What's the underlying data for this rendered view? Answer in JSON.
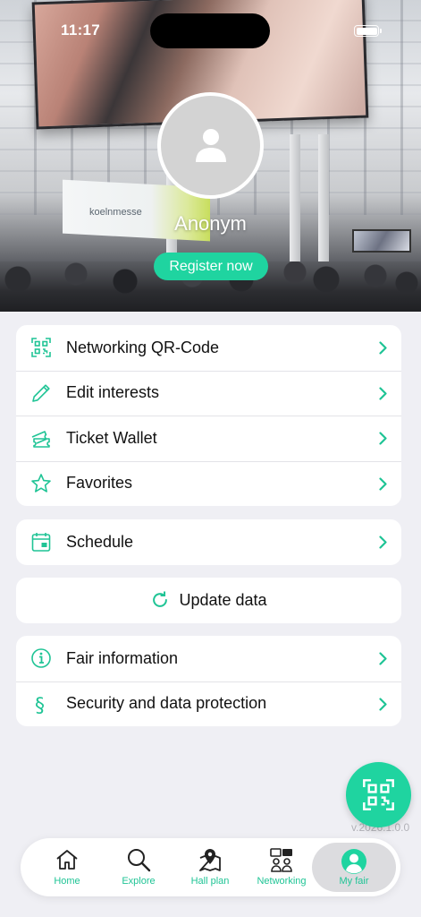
{
  "status_bar": {
    "time": "11:17"
  },
  "hero": {
    "sign_text": "koelnmesse",
    "user_name": "Anonym",
    "register_label": "Register now"
  },
  "menu": {
    "group1": [
      {
        "label": "Networking QR-Code",
        "icon": "qr-code-icon"
      },
      {
        "label": "Edit interests",
        "icon": "pencil-icon"
      },
      {
        "label": "Ticket Wallet",
        "icon": "ticket-icon"
      },
      {
        "label": "Favorites",
        "icon": "star-icon"
      }
    ],
    "group2": [
      {
        "label": "Schedule",
        "icon": "calendar-icon"
      }
    ],
    "update": {
      "label": "Update data",
      "icon": "refresh-icon"
    },
    "group3": [
      {
        "label": "Fair information",
        "icon": "info-icon"
      },
      {
        "label": "Security and data protection",
        "icon": "paragraph-icon"
      }
    ]
  },
  "version": "v.2026.1.0.0",
  "tabbar": [
    {
      "label": "Home",
      "icon": "home-icon"
    },
    {
      "label": "Explore",
      "icon": "search-icon"
    },
    {
      "label": "Hall plan",
      "icon": "map-pin-icon"
    },
    {
      "label": "Networking",
      "icon": "chat-people-icon"
    },
    {
      "label": "My fair",
      "icon": "user-circle-icon",
      "active": true
    }
  ],
  "colors": {
    "accent": "#1fd4a0",
    "accent_text": "#1fc495",
    "background": "#efeff4",
    "card": "#ffffff"
  }
}
